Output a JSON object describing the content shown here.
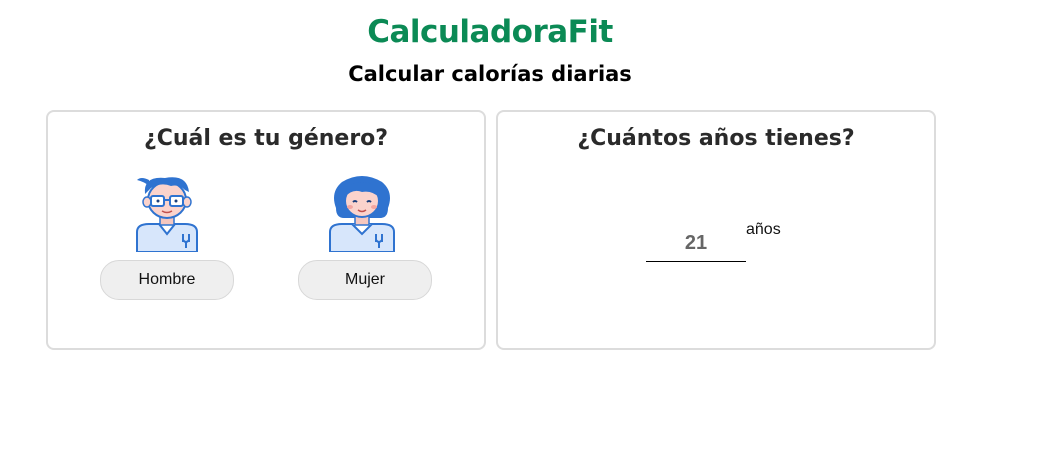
{
  "header": {
    "app_title": "CalculadoraFit",
    "subtitle": "Calcular calorías diarias"
  },
  "gender_card": {
    "title": "¿Cuál es tu género?",
    "options": [
      {
        "label": "Hombre",
        "icon": "male-avatar-icon"
      },
      {
        "label": "Mujer",
        "icon": "female-avatar-icon"
      }
    ]
  },
  "age_card": {
    "title": "¿Cuántos años tienes?",
    "value": "21",
    "unit": "años"
  },
  "colors": {
    "brand": "#0b8a55",
    "avatar_blue": "#2f73d0",
    "button_bg": "#efefef",
    "card_border": "#dcdcdc"
  }
}
